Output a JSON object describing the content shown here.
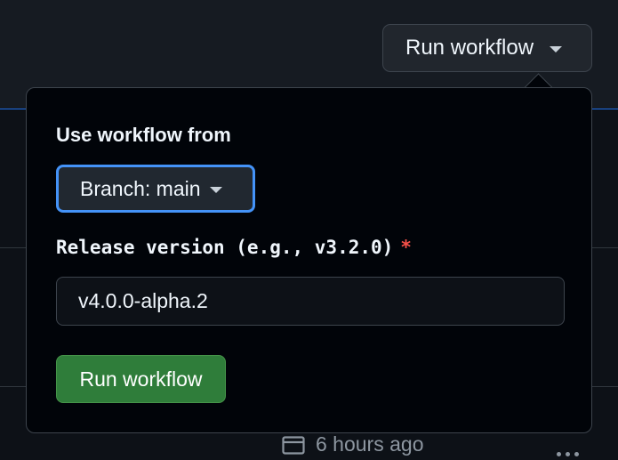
{
  "header": {
    "run_workflow_toggle_label": "Run workflow"
  },
  "dialog": {
    "use_workflow_from_label": "Use workflow from",
    "branch_selector_label": "Branch: main",
    "release_version_label": "Release version (e.g., v3.2.0)",
    "required_marker": "*",
    "release_version_value": "v4.0.0-alpha.2",
    "submit_label": "Run workflow"
  },
  "run_row": {
    "timestamp": "6 hours ago",
    "timestamp_icon": "calendar-icon",
    "more_icon": "kebab-horizontal-icon"
  },
  "colors": {
    "accent_focus": "#4493f8",
    "submit_green": "#2f7d3a",
    "required_red": "#f85149",
    "background": "#0d1117",
    "popover_background": "#010409"
  }
}
